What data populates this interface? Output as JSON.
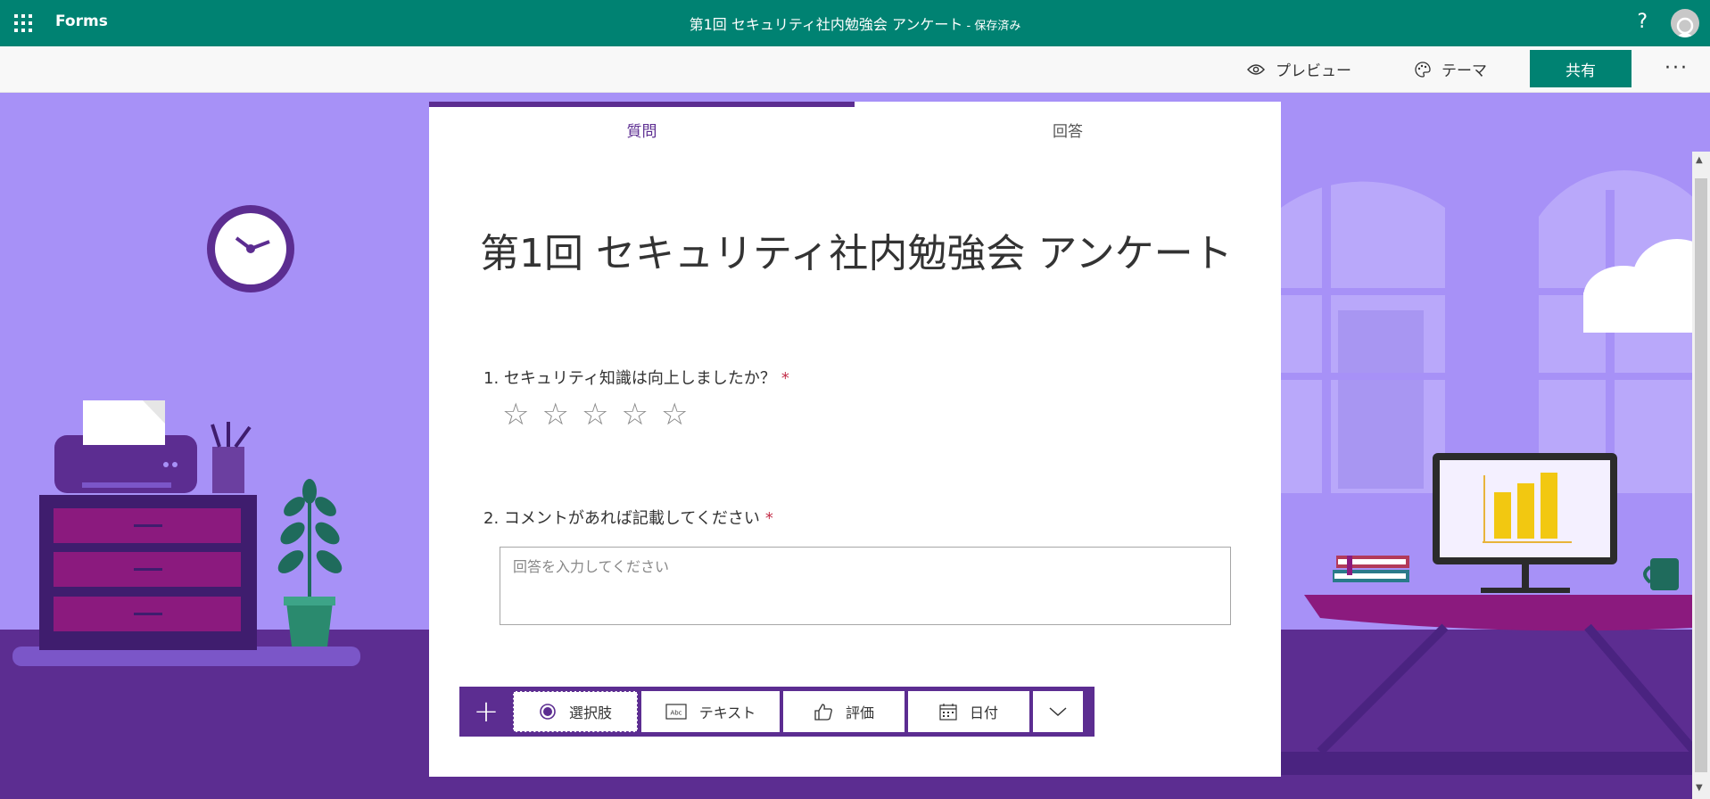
{
  "topbar": {
    "app_name": "Forms",
    "doc_title": "第1回 セキュリティ社内勉強会 アンケート",
    "saved_status": " - 保存済み",
    "help": "?"
  },
  "commandbar": {
    "preview_label": "プレビュー",
    "theme_label": "テーマ",
    "share_label": "共有",
    "more_label": "···"
  },
  "tabs": {
    "questions": "質問",
    "responses": "回答"
  },
  "form": {
    "title": "第1回 セキュリティ社内勉強会 アンケート",
    "questions": [
      {
        "number": "1.",
        "text": "セキュリティ知識は向上しましたか？",
        "required_mark": "*",
        "type": "rating",
        "stars": [
          "☆",
          "☆",
          "☆",
          "☆",
          "☆"
        ]
      },
      {
        "number": "2.",
        "text": "コメントがあれば記載してください",
        "required_mark": "*",
        "type": "text",
        "placeholder": "回答を入力してください"
      }
    ]
  },
  "add_toolbar": {
    "plus": "+",
    "choice_label": "選択肢",
    "text_label": "テキスト",
    "rating_label": "評価",
    "date_label": "日付",
    "more_icon": "chevron-down-icon"
  },
  "colors": {
    "brand": "#008272",
    "accent": "#5c2d91",
    "background": "#a48ff5",
    "required": "#c4314b"
  }
}
